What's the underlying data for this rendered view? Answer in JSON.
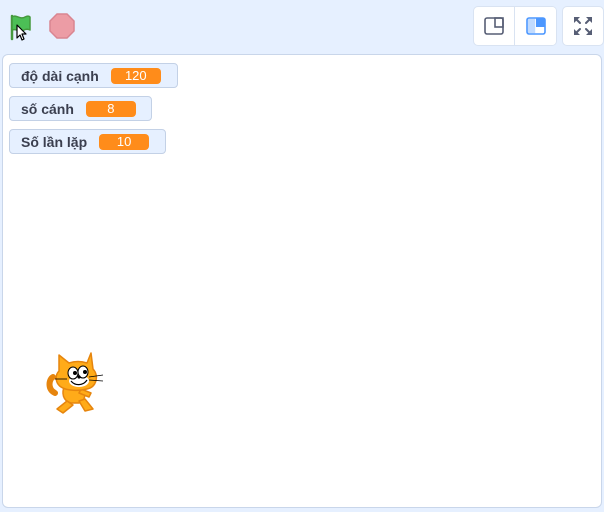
{
  "topbar": {
    "green_flag_icon": "green-flag-icon",
    "stop_icon": "stop-icon",
    "small_stage_icon": "small-stage-icon",
    "large_stage_icon": "large-stage-icon",
    "fullscreen_icon": "fullscreen-icon"
  },
  "monitors": [
    {
      "label": "độ dài cạnh",
      "value": "120"
    },
    {
      "label": "số cánh",
      "value": "8"
    },
    {
      "label": "Số lần lặp",
      "value": "10"
    }
  ],
  "sprite": {
    "name_icon": "scratch-cat-sprite"
  },
  "colors": {
    "accent": "#ff8c1a",
    "flag": "#4cbf56",
    "stop": "#ec9ca5",
    "active_mode": "#4c97ff"
  }
}
